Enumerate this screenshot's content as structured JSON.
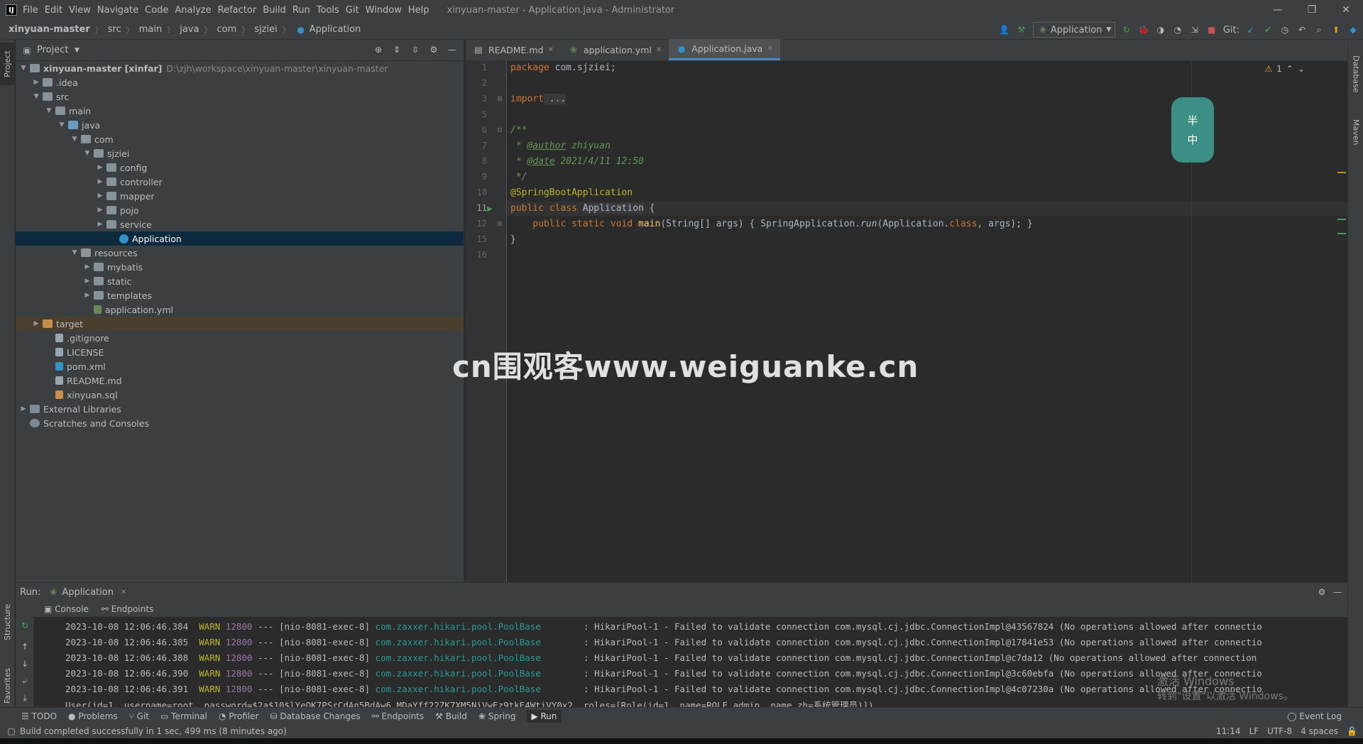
{
  "titlebar": {
    "logo": "IJ",
    "menu": [
      "File",
      "Edit",
      "View",
      "Navigate",
      "Code",
      "Analyze",
      "Refactor",
      "Build",
      "Run",
      "Tools",
      "Git",
      "Window",
      "Help"
    ],
    "title": "xinyuan-master - Application.java - Administrator"
  },
  "navbar": {
    "crumbs": [
      "xinyuan-master",
      "src",
      "main",
      "java",
      "com",
      "sjziei",
      "Application"
    ],
    "run_config": "Application",
    "git_label": "Git:"
  },
  "project": {
    "title": "Project",
    "tree": [
      {
        "label": "xinyuan-master [xinfar]",
        "path": "D:\\zjh\\workspace\\xinyuan-master\\xinyuan-master"
      },
      {
        "label": ".idea"
      },
      {
        "label": "src"
      },
      {
        "label": "main"
      },
      {
        "label": "java"
      },
      {
        "label": "com"
      },
      {
        "label": "sjziei"
      },
      {
        "label": "config"
      },
      {
        "label": "controller"
      },
      {
        "label": "mapper"
      },
      {
        "label": "pojo"
      },
      {
        "label": "service"
      },
      {
        "label": "Application"
      },
      {
        "label": "resources"
      },
      {
        "label": "mybatis"
      },
      {
        "label": "static"
      },
      {
        "label": "templates"
      },
      {
        "label": "application.yml"
      },
      {
        "label": "target"
      },
      {
        "label": ".gitignore"
      },
      {
        "label": "LICENSE"
      },
      {
        "label": "pom.xml"
      },
      {
        "label": "README.md"
      },
      {
        "label": "xinyuan.sql"
      },
      {
        "label": "External Libraries"
      },
      {
        "label": "Scratches and Consoles"
      }
    ]
  },
  "tabs": [
    "README.md",
    "application.yml",
    "Application.java"
  ],
  "editor": {
    "line_numbers": [
      "1",
      "2",
      "3",
      "5",
      "6",
      "7",
      "8",
      "9",
      "10",
      "11",
      "12",
      "15",
      "16"
    ],
    "warning_count": "1",
    "l_package_kw": "package",
    "l_package_rest": " com.sjziei;",
    "l_import_kw": "import",
    "l_import_rest": " ...",
    "l_doc_open": "/**",
    "l_author_pre": " * ",
    "l_author_tag": "@author",
    "l_author_val": " zhiyuan",
    "l_date_pre": " * ",
    "l_date_tag": "@date",
    "l_date_val": " 2021/4/11 12:50",
    "l_doc_close": " */",
    "l_ann": "@SpringBootApplication",
    "l_class_kw": "public class ",
    "l_class_name": "Application",
    "l_class_rest": " {",
    "l_main_kw": "    public static void ",
    "l_main_name": "main",
    "l_main_args": "(String[] args) { SpringApplication.",
    "l_main_run": "run",
    "l_main_rest1": "(Application.",
    "l_main_class": "class",
    "l_main_rest2": ", args); }",
    "l_close": "}"
  },
  "widget": {
    "top": "半",
    "bottom": "中"
  },
  "watermark": "cn围观客www.weiguanke.cn",
  "run": {
    "label": "Run:",
    "tab": "Application",
    "console": "Console",
    "endpoints": "Endpoints",
    "logs": [
      {
        "ts": "2023-10-08 12:06:46.384",
        "lvl": "WARN",
        "pid": "12800",
        "thread": "--- [nio-8081-exec-8]",
        "logger": "com.zaxxer.hikari.pool.PoolBase",
        "msg": "        : HikariPool-1 - Failed to validate connection com.mysql.cj.jdbc.ConnectionImpl@43567824 (No operations allowed after connectio"
      },
      {
        "ts": "2023-10-08 12:06:46.385",
        "lvl": "WARN",
        "pid": "12800",
        "thread": "--- [nio-8081-exec-8]",
        "logger": "com.zaxxer.hikari.pool.PoolBase",
        "msg": "        : HikariPool-1 - Failed to validate connection com.mysql.cj.jdbc.ConnectionImpl@17841e53 (No operations allowed after connectio"
      },
      {
        "ts": "2023-10-08 12:06:46.388",
        "lvl": "WARN",
        "pid": "12800",
        "thread": "--- [nio-8081-exec-8]",
        "logger": "com.zaxxer.hikari.pool.PoolBase",
        "msg": "        : HikariPool-1 - Failed to validate connection com.mysql.cj.jdbc.ConnectionImpl@c7da12 (No operations allowed after connection"
      },
      {
        "ts": "2023-10-08 12:06:46.390",
        "lvl": "WARN",
        "pid": "12800",
        "thread": "--- [nio-8081-exec-8]",
        "logger": "com.zaxxer.hikari.pool.PoolBase",
        "msg": "        : HikariPool-1 - Failed to validate connection com.mysql.cj.jdbc.ConnectionImpl@3c60ebfa (No operations allowed after connectio"
      },
      {
        "ts": "2023-10-08 12:06:46.391",
        "lvl": "WARN",
        "pid": "12800",
        "thread": "--- [nio-8081-exec-8]",
        "logger": "com.zaxxer.hikari.pool.PoolBase",
        "msg": "        : HikariPool-1 - Failed to validate connection com.mysql.cj.jdbc.ConnectionImpl@4c07230a (No operations allowed after connectio"
      }
    ],
    "last_line": "User(id=1, username=root, password=$2a$10$lYeOK7PSrCdAn5BdAw6.MDaYff22ZK7XM5NiVwEz9tkE4WtiVY0x2, roles=[Role(id=1, name=ROLE_admin, name_zh=系统管理员)])"
  },
  "bottom_tools": [
    "TODO",
    "Problems",
    "Git",
    "Terminal",
    "Profiler",
    "Database Changes",
    "Endpoints",
    "Build",
    "Spring",
    "Run"
  ],
  "status": {
    "message": "Build completed successfully in 1 sec, 499 ms (8 minutes ago)",
    "pos": "11:14",
    "lf": "LF",
    "enc": "UTF-8",
    "indent": "4 spaces",
    "event_log": "Event Log"
  },
  "win_activate": {
    "line1": "激活 Windows",
    "line2": "转到\"设置\"以激活 Windows。"
  },
  "left_tools": {
    "project": "Project",
    "structure": "Structure",
    "favorites": "Favorites"
  },
  "right_tools": {
    "database": "Database",
    "maven": "Maven"
  }
}
